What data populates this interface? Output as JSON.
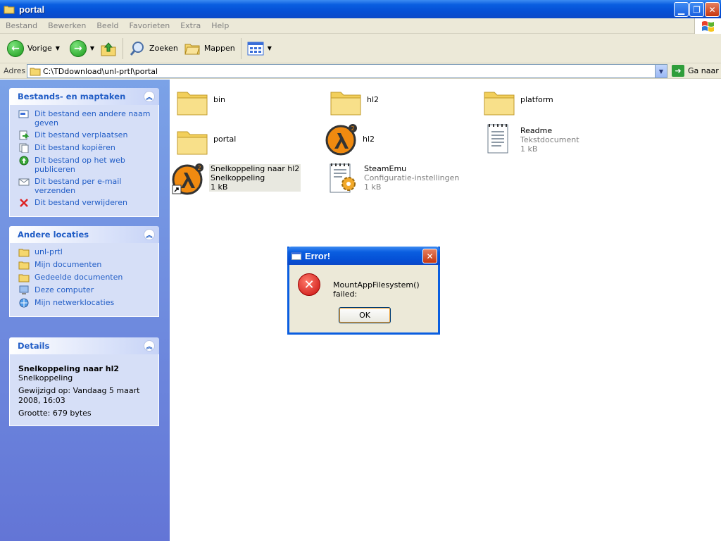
{
  "window": {
    "title": "portal"
  },
  "menu": [
    "Bestand",
    "Bewerken",
    "Beeld",
    "Favorieten",
    "Extra",
    "Help"
  ],
  "toolbar": {
    "back": "Vorige",
    "search": "Zoeken",
    "folders": "Mappen"
  },
  "address": {
    "label": "Adres",
    "value": "C:\\TDdownload\\unl-prtl\\portal",
    "go": "Ga naar"
  },
  "sidebar": {
    "tasks": {
      "title": "Bestands- en maptaken",
      "items": [
        "Dit bestand een andere naam geven",
        "Dit bestand verplaatsen",
        "Dit bestand kopiëren",
        "Dit bestand op het web publiceren",
        "Dit bestand per e-mail verzenden",
        "Dit bestand verwijderen"
      ]
    },
    "locations": {
      "title": "Andere locaties",
      "items": [
        "unl-prtl",
        "Mijn documenten",
        "Gedeelde documenten",
        "Deze computer",
        "Mijn netwerklocaties"
      ]
    },
    "details": {
      "title": "Details",
      "name": "Snelkoppeling naar hl2",
      "type": "Snelkoppeling",
      "modified": "Gewijzigd op: Vandaag 5 maart 2008, 16:03",
      "size": "Grootte: 679 bytes"
    }
  },
  "files": [
    {
      "name": "bin",
      "sub1": "",
      "sub2": ""
    },
    {
      "name": "hl2",
      "sub1": "",
      "sub2": ""
    },
    {
      "name": "platform",
      "sub1": "",
      "sub2": ""
    },
    {
      "name": "portal",
      "sub1": "",
      "sub2": ""
    },
    {
      "name": "hl2",
      "sub1": "",
      "sub2": ""
    },
    {
      "name": "Readme",
      "sub1": "Tekstdocument",
      "sub2": "1 kB"
    },
    {
      "name": "Snelkoppeling naar hl2",
      "sub1": "Snelkoppeling",
      "sub2": "1 kB"
    },
    {
      "name": "SteamEmu",
      "sub1": "Configuratie-instellingen",
      "sub2": "1 kB"
    }
  ],
  "dialog": {
    "title": "Error!",
    "message": "MountAppFilesystem() failed:",
    "ok": "OK"
  },
  "colors": {
    "title_bar": "#0a5ee0",
    "sidebar_bg": "#6f8ddf",
    "link": "#215dc6"
  }
}
